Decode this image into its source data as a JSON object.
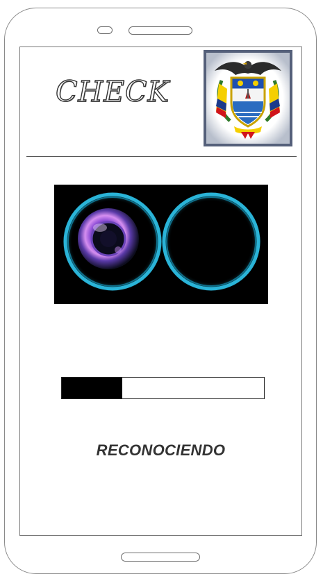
{
  "app": {
    "title": "CHECK"
  },
  "progress": {
    "value": 0.3
  },
  "status": {
    "label": "RECONOCIENDO"
  },
  "icons": {
    "emblem": "colombia-coat-of-arms",
    "camera": "dual-camera-lens-infinity"
  },
  "colors": {
    "progress_fill": "#000000",
    "lens_ring": "#2ab4d8",
    "frame": "#8a8a8a"
  }
}
